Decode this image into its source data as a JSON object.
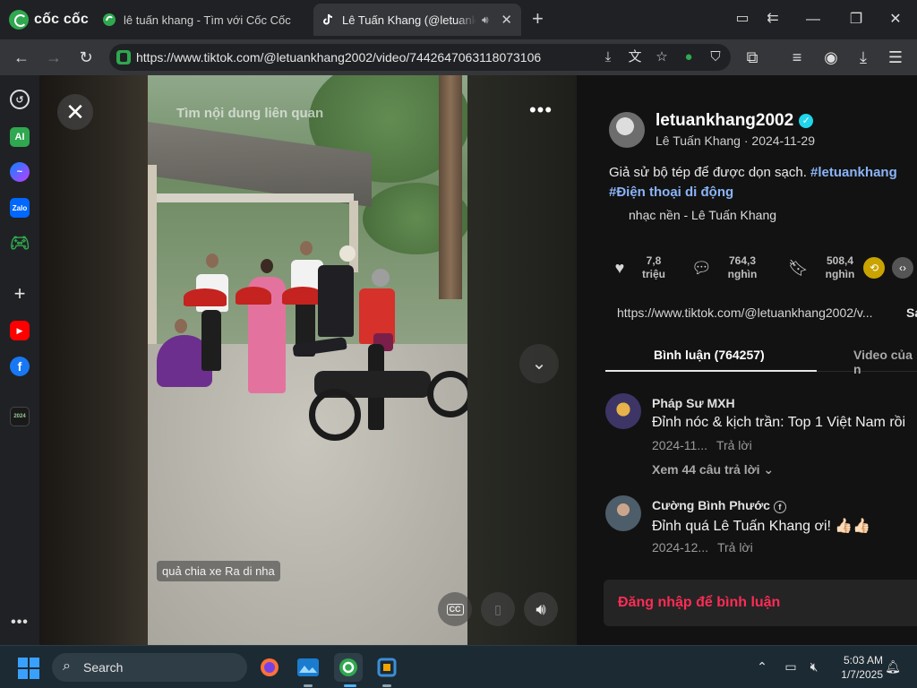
{
  "browser": {
    "brand": "cốc cốc",
    "tabs": [
      {
        "title": "lê tuấn khang - Tìm với Cốc Cốc",
        "active": false
      },
      {
        "title": "Lê Tuấn Khang (@letuank",
        "active": true
      }
    ],
    "url": "https://www.tiktok.com/@letuankhang2002/video/7442647063118073106",
    "accent": "#2fa84f"
  },
  "video": {
    "related_overlay": "Tìm nội dung liên quan",
    "caption": "quả chia xe Ra di nha"
  },
  "panel": {
    "username": "letuankhang2002",
    "display_line": "Lê Tuấn Khang · 2024-11-29",
    "description_text": "Giả sử bộ tép để được dọn sạch. ",
    "hashtag1": "#letuankhang",
    "hashtag2": "#Điện thoại di động",
    "music": "nhạc nền - Lê Tuấn Khang",
    "likes": {
      "value": "7,8",
      "unit": "triệu"
    },
    "comments": {
      "value": "764,3",
      "unit": "nghìn"
    },
    "saves": {
      "value": "508,4",
      "unit": "nghìn"
    },
    "link": "https://www.tiktok.com/@letuankhang2002/v...",
    "link_more": "Sa",
    "tab_comments": "Bình luận (764257)",
    "tab_videos": "Video của n",
    "comments_list": [
      {
        "author": "Pháp Sư MXH",
        "text": "Đỉnh nóc & kịch trần: Top 1 Việt Nam rồi",
        "date": "2024-11...",
        "reply": "Trả lời",
        "more": "Xem 44 câu trả lời"
      },
      {
        "author": "Cường Bình Phước",
        "text": "Đỉnh quá Lê Tuấn Khang ơi! 👍🏻👍🏻",
        "date": "2024-12...",
        "reply": "Trả lời"
      }
    ],
    "login_prompt": "Đăng nhập để bình luận",
    "brand_red": "#fe2c55"
  },
  "taskbar": {
    "search_label": "Search",
    "time": "5:03 AM",
    "date": "1/7/2025"
  }
}
